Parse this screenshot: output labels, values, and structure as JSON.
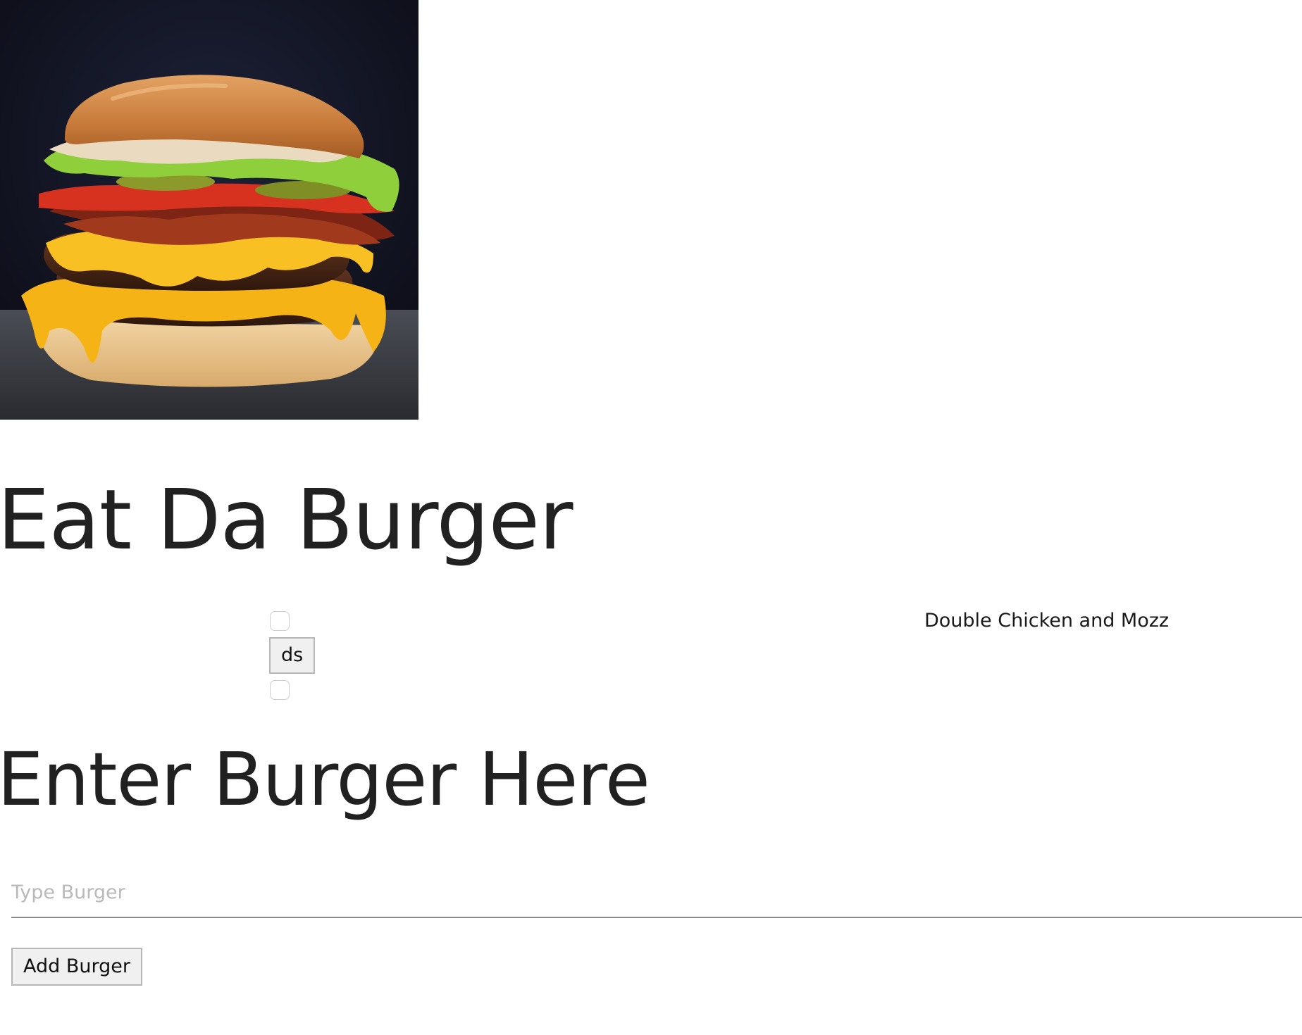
{
  "hero": {
    "icon": "burger-photo"
  },
  "header": {
    "title": "Eat Da Burger"
  },
  "burgers": {
    "items": [
      {
        "button_label": "ds"
      }
    ],
    "devoured_list": [
      {
        "name": "Double Chicken and Mozz"
      }
    ]
  },
  "form": {
    "heading": "Enter Burger Here",
    "input_placeholder": "Type Burger",
    "input_value": "",
    "submit_label": "Add Burger"
  }
}
